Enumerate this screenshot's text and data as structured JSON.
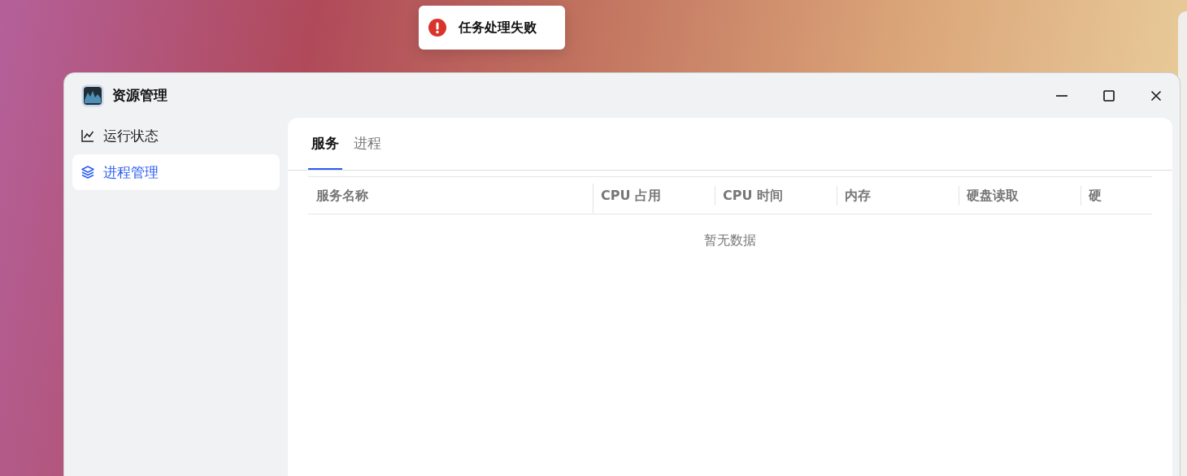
{
  "toast": {
    "kind": "error",
    "message": "任务处理失败"
  },
  "window": {
    "title": "资源管理"
  },
  "sidebar": {
    "items": [
      {
        "label": "运行状态",
        "kind": "chart",
        "selected": false
      },
      {
        "label": "进程管理",
        "kind": "layers",
        "selected": true
      }
    ]
  },
  "tabs": [
    {
      "label": "服务",
      "selected": true
    },
    {
      "label": "进程",
      "selected": false
    }
  ],
  "table": {
    "columns": [
      "服务名称",
      "CPU 占用",
      "CPU 时间",
      "内存",
      "硬盘读取",
      "硬"
    ],
    "empty_text": "暂无数据"
  }
}
